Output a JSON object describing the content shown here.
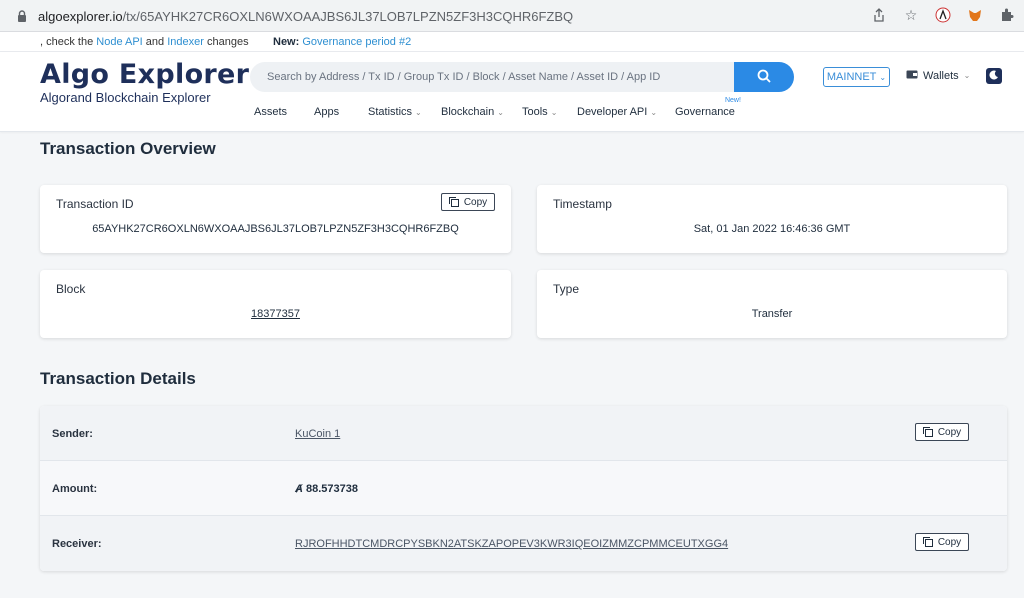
{
  "browser": {
    "url_host": "algoexplorer.io",
    "url_path": "/tx/65AYHK27CR6OXLN6WXOAAJBS6JL37LOB7LPZN5ZF3H3CQHR6FZBQ"
  },
  "announcement": {
    "prefix": ", check the ",
    "node_api": "Node API",
    "and": " and ",
    "indexer": "Indexer",
    "changes": " changes",
    "new_label": "New:",
    "governance_link": "Governance period #2"
  },
  "header": {
    "logo_title": "Algo Explorer",
    "logo_subtitle": "Algorand Blockchain Explorer",
    "search_placeholder": "Search by Address / Tx ID / Group Tx ID / Block / Asset Name / Asset ID / App ID",
    "network": "MAINNET",
    "wallets": "Wallets"
  },
  "nav": {
    "items": [
      {
        "label": "Assets"
      },
      {
        "label": "Apps"
      },
      {
        "label": "Statistics"
      },
      {
        "label": "Blockchain"
      },
      {
        "label": "Tools"
      },
      {
        "label": "Developer API"
      },
      {
        "label": "Governance",
        "badge": "New!"
      }
    ]
  },
  "overview": {
    "title": "Transaction Overview",
    "tx_id_label": "Transaction ID",
    "tx_id": "65AYHK27CR6OXLN6WXOAAJBS6JL37LOB7LPZN5ZF3H3CQHR6FZBQ",
    "timestamp_label": "Timestamp",
    "timestamp": "Sat, 01 Jan 2022 16:46:36 GMT",
    "block_label": "Block",
    "block": "18377357",
    "type_label": "Type",
    "type": "Transfer",
    "copy_label": "Copy"
  },
  "details": {
    "title": "Transaction Details",
    "sender_label": "Sender:",
    "sender": "KuCoin 1",
    "amount_label": "Amount:",
    "amount": "88.573738",
    "receiver_label": "Receiver:",
    "receiver": "RJROFHHDTCMDRCPYSBKN2ATSKZAPOPEV3KWR3IQEOIZMMZCPMMCEUTXGG4",
    "copy_label": "Copy"
  },
  "colors": {
    "accent": "#2b8ae5",
    "brand": "#1e2f5a"
  }
}
